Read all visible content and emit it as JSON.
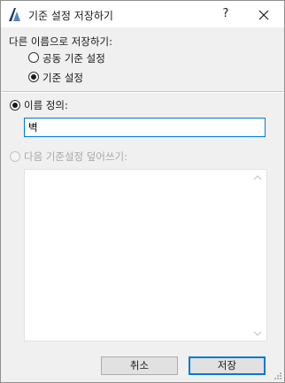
{
  "window": {
    "title": "기준 설정 저장하기",
    "help_label": "?",
    "icons": {
      "app": "archicad-app-icon",
      "close": "close-icon",
      "grip": "resize-grip-icon"
    }
  },
  "save_as_section": {
    "label": "다른 이름으로 저장하기:",
    "options": [
      {
        "label": "공동 기준 설정",
        "checked": false
      },
      {
        "label": "기준 설정",
        "checked": true
      }
    ]
  },
  "define_name": {
    "label": "이름 정의:",
    "checked": true,
    "input_value": "벽"
  },
  "overwrite": {
    "label": "다음 기준설정 덮어쓰기:",
    "enabled": false,
    "items": []
  },
  "buttons": {
    "cancel": "취소",
    "save": "저장"
  },
  "colors": {
    "accent": "#0078d7",
    "dialog_bg": "#f0f0f0",
    "disabled_text": "#a8a8a8"
  }
}
